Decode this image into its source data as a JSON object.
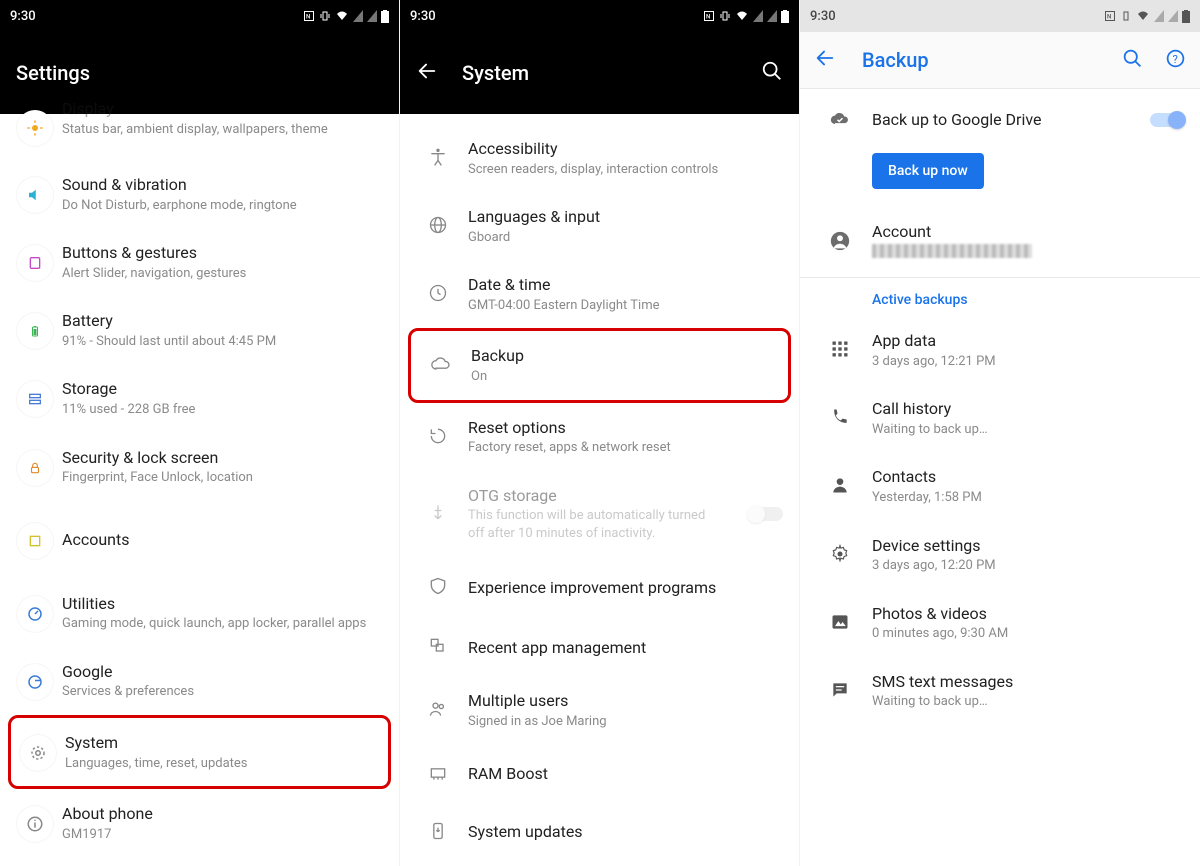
{
  "status_time": "9:30",
  "s1": {
    "title": "Settings",
    "display": {
      "ttl": "Display",
      "sub": "Status bar, ambient display, wallpapers, theme"
    },
    "sound": {
      "ttl": "Sound & vibration",
      "sub": "Do Not Disturb, earphone mode, ringtone"
    },
    "buttons": {
      "ttl": "Buttons & gestures",
      "sub": "Alert Slider, navigation, gestures"
    },
    "battery": {
      "ttl": "Battery",
      "sub": "91% - Should last until about 4:45 PM"
    },
    "storage": {
      "ttl": "Storage",
      "sub": "11% used - 228 GB free"
    },
    "security": {
      "ttl": "Security & lock screen",
      "sub": "Fingerprint, Face Unlock, location"
    },
    "accounts": {
      "ttl": "Accounts"
    },
    "utilities": {
      "ttl": "Utilities",
      "sub": "Gaming mode, quick launch, app locker, parallel apps"
    },
    "google": {
      "ttl": "Google",
      "sub": "Services & preferences"
    },
    "system": {
      "ttl": "System",
      "sub": "Languages, time, reset, updates"
    },
    "about": {
      "ttl": "About phone",
      "sub": "GM1917"
    }
  },
  "s2": {
    "title": "System",
    "access": {
      "ttl": "Accessibility",
      "sub": "Screen readers, display, interaction controls"
    },
    "lang": {
      "ttl": "Languages & input",
      "sub": "Gboard"
    },
    "date": {
      "ttl": "Date & time",
      "sub": "GMT-04:00 Eastern Daylight Time"
    },
    "backup": {
      "ttl": "Backup",
      "sub": "On"
    },
    "reset": {
      "ttl": "Reset options",
      "sub": "Factory reset, apps & network reset"
    },
    "otg": {
      "ttl": "OTG storage",
      "sub": "This function will be automatically turned off after 10 minutes of inactivity."
    },
    "exp": {
      "ttl": "Experience improvement programs"
    },
    "recent": {
      "ttl": "Recent app management"
    },
    "multi": {
      "ttl": "Multiple users",
      "sub": "Signed in as Joe Maring"
    },
    "ram": {
      "ttl": "RAM Boost"
    },
    "sysup": {
      "ttl": "System updates"
    }
  },
  "s3": {
    "title": "Backup",
    "gdrive": {
      "ttl": "Back up to Google Drive"
    },
    "btn": "Back up now",
    "account": {
      "ttl": "Account"
    },
    "section": "Active backups",
    "appdata": {
      "ttl": "App data",
      "sub": "3 days ago, 12:21 PM"
    },
    "call": {
      "ttl": "Call history",
      "sub": "Waiting to back up…"
    },
    "contacts": {
      "ttl": "Contacts",
      "sub": "Yesterday, 1:58 PM"
    },
    "device": {
      "ttl": "Device settings",
      "sub": "3 days ago, 12:20 PM"
    },
    "photos": {
      "ttl": "Photos & videos",
      "sub": "0 minutes ago, 9:30 AM"
    },
    "sms": {
      "ttl": "SMS text messages",
      "sub": "Waiting to back up…"
    }
  }
}
